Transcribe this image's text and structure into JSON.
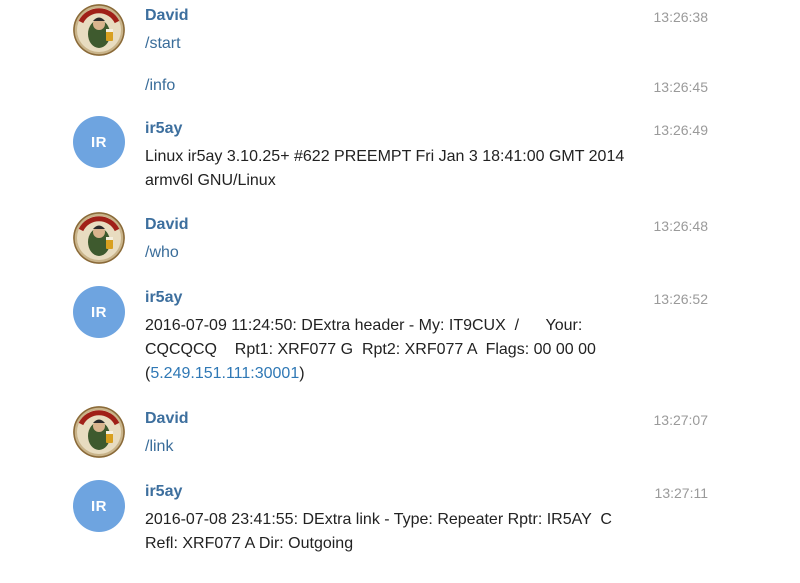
{
  "messages": [
    {
      "sender": "David",
      "time": "13:26:38",
      "text": "/start"
    },
    {
      "time": "13:26:45",
      "text": "/info"
    },
    {
      "sender": "ir5ay",
      "avatar_initials": "IR",
      "time": "13:26:49",
      "text": "Linux ir5ay 3.10.25+ #622 PREEMPT Fri Jan 3 18:41:00 GMT 2014\narmv6l GNU/Linux"
    },
    {
      "sender": "David",
      "time": "13:26:48",
      "text": "/who"
    },
    {
      "sender": "ir5ay",
      "avatar_initials": "IR",
      "time": "13:26:52",
      "text_before_link": "2016-07-09 11:24:50: DExtra header - My: IT9CUX  /      Your:\nCQCQCQ    Rpt1: XRF077 G  Rpt2: XRF077 A  Flags: 00 00 00\n(",
      "link": "5.249.151.111:30001",
      "text_after_link": ")"
    },
    {
      "sender": "David",
      "time": "13:27:07",
      "text": "/link"
    },
    {
      "sender": "ir5ay",
      "avatar_initials": "IR",
      "time": "13:27:11",
      "text": "2016-07-08 23:41:55: DExtra link - Type: Repeater Rptr: IR5AY  C\nRefl: XRF077 A Dir: Outgoing"
    }
  ],
  "avatar_david_label": "BIRRA MORETTI",
  "colors": {
    "sender": "#3d6f9e",
    "command": "#3a6d9a",
    "link": "#2f78b5",
    "timestamp": "#9a9a9a",
    "bot_avatar": "#6ea4e0"
  }
}
